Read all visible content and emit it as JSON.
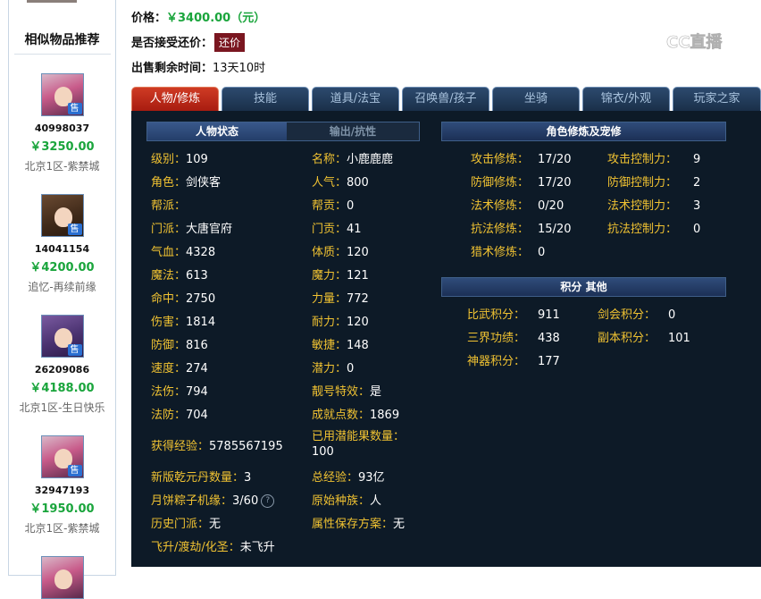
{
  "sidebar": {
    "title": "相似物品推荐",
    "items": [
      {
        "id": "40998037",
        "price": "￥3250.00",
        "server": "北京1区-紫禁城",
        "sale": "售"
      },
      {
        "id": "14041154",
        "price": "￥4200.00",
        "server": "追忆-再续前缘",
        "sale": "售"
      },
      {
        "id": "26209086",
        "price": "￥4188.00",
        "server": "北京1区-生日快乐",
        "sale": "售"
      },
      {
        "id": "32947193",
        "price": "￥1950.00",
        "server": "北京1区-紫禁城",
        "sale": "售"
      }
    ]
  },
  "info": {
    "price_label": "价格：",
    "price_value": "￥3400.00（元）",
    "bargain_label": "是否接受还价：",
    "bargain_button": "还价",
    "time_label": "出售剩余时间：",
    "time_value": "13天10时"
  },
  "logo": {
    "text": "CC直播"
  },
  "tabs": [
    "人物/修炼",
    "技能",
    "道具/法宝",
    "召唤兽/孩子",
    "坐骑",
    "锦衣/外观",
    "玩家之家"
  ],
  "status": {
    "tab_active": "人物状态",
    "tab_inactive": "输出/抗性",
    "left": [
      {
        "label": "级别：",
        "value": "109"
      },
      {
        "label": "角色：",
        "value": "剑侠客"
      },
      {
        "label": "帮派：",
        "value": ""
      },
      {
        "label": "门派：",
        "value": "大唐官府"
      },
      {
        "label": "气血：",
        "value": "4328"
      },
      {
        "label": "魔法：",
        "value": "613"
      },
      {
        "label": "命中：",
        "value": "2750"
      },
      {
        "label": "伤害：",
        "value": "1814"
      },
      {
        "label": "防御：",
        "value": "816"
      },
      {
        "label": "速度：",
        "value": "274"
      },
      {
        "label": "法伤：",
        "value": "794"
      },
      {
        "label": "法防：",
        "value": "704"
      }
    ],
    "right": [
      {
        "label": "名称：",
        "value": "小鹿鹿鹿"
      },
      {
        "label": "人气：",
        "value": "800"
      },
      {
        "label": "帮贡：",
        "value": "0"
      },
      {
        "label": "门贡：",
        "value": "41"
      },
      {
        "label": "体质：",
        "value": "120"
      },
      {
        "label": "魔力：",
        "value": "121"
      },
      {
        "label": "力量：",
        "value": "772"
      },
      {
        "label": "耐力：",
        "value": "120"
      },
      {
        "label": "敏捷：",
        "value": "148"
      },
      {
        "label": "潜力：",
        "value": "0"
      },
      {
        "label": "靓号特效：",
        "value": "是"
      },
      {
        "label": "成就点数：",
        "value": "1869"
      }
    ],
    "exp": {
      "label": "获得经验：",
      "value": "5785567195"
    },
    "potion": {
      "label": "已用潜能果数量：",
      "value": "100"
    },
    "qianyuan": {
      "label": "新版乾元丹数量：",
      "value": "3"
    },
    "total_exp": {
      "label": "总经验：",
      "value": "93亿"
    },
    "mooncake": {
      "label": "月饼粽子机缘：",
      "value": "3/60"
    },
    "race": {
      "label": "原始种族：",
      "value": "人"
    },
    "history": {
      "label": "历史门派：",
      "value": "无"
    },
    "attr_plan": {
      "label": "属性保存方案：",
      "value": "无"
    },
    "ascend": {
      "label": "飞升/渡劫/化圣：",
      "value": "未飞升"
    }
  },
  "cultivation": {
    "title": "角色修炼及宠修",
    "left": [
      {
        "label": "攻击修炼：",
        "value": "17/20"
      },
      {
        "label": "防御修炼：",
        "value": "17/20"
      },
      {
        "label": "法术修炼：",
        "value": "0/20"
      },
      {
        "label": "抗法修炼：",
        "value": "15/20"
      },
      {
        "label": "猎术修炼：",
        "value": "0"
      }
    ],
    "right": [
      {
        "label": "攻击控制力：",
        "value": "9"
      },
      {
        "label": "防御控制力：",
        "value": "2"
      },
      {
        "label": "法术控制力：",
        "value": "3"
      },
      {
        "label": "抗法控制力：",
        "value": "0"
      }
    ]
  },
  "scores": {
    "title": "积分 其他",
    "left": [
      {
        "label": "比武积分：",
        "value": "911"
      },
      {
        "label": "三界功绩：",
        "value": "438"
      },
      {
        "label": "神器积分：",
        "value": "177"
      }
    ],
    "right": [
      {
        "label": "剑会积分：",
        "value": "0"
      },
      {
        "label": "副本积分：",
        "value": "101"
      }
    ]
  },
  "colors": {
    "label": "#f0c232",
    "price": "#1aa53c",
    "panel": "#0d1a27",
    "active_tab": "#c0301e"
  }
}
